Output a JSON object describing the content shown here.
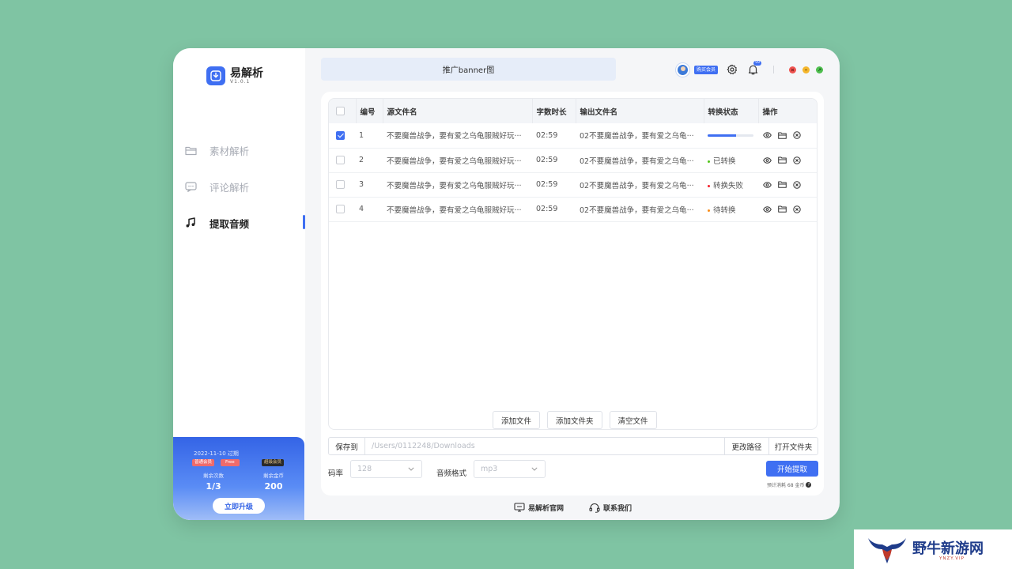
{
  "app": {
    "name": "易解析",
    "version": "V1.0.1"
  },
  "sidebar": {
    "items": [
      {
        "label": "素材解析",
        "icon": "folder-icon",
        "active": false
      },
      {
        "label": "评论解析",
        "icon": "comment-icon",
        "active": false
      },
      {
        "label": "提取音频",
        "icon": "music-note-icon",
        "active": true
      }
    ]
  },
  "member": {
    "expire": "2022-11-10 过期",
    "badge_normal": "普通会员",
    "badge_free": "Free",
    "badge_super": "超级会员",
    "remaining_times_label": "剩余次数",
    "remaining_times": "1/3",
    "remaining_coins_label": "剩余金币",
    "remaining_coins": "200",
    "upgrade_label": "立即升级"
  },
  "header": {
    "banner": "推广banner图",
    "buy_member": "购买会员",
    "bell_count": "99"
  },
  "table": {
    "columns": [
      "编号",
      "源文件名",
      "字数时长",
      "输出文件名",
      "转换状态",
      "操作"
    ],
    "rows": [
      {
        "id": "1",
        "source": "不要魔兽战争，要有爱之乌龟服贼好玩···",
        "duration": "02:59",
        "output": "02不要魔兽战争，要有爱之乌龟···",
        "status": "",
        "status_type": "progress",
        "progress": 0.62,
        "checked": true
      },
      {
        "id": "2",
        "source": "不要魔兽战争，要有爱之乌龟服贼好玩···",
        "duration": "02:59",
        "output": "02不要魔兽战争，要有爱之乌龟···",
        "status": "已转换",
        "status_type": "done",
        "status_color": "#52c41a",
        "checked": false
      },
      {
        "id": "3",
        "source": "不要魔兽战争，要有爱之乌龟服贼好玩···",
        "duration": "02:59",
        "output": "02不要魔兽战争，要有爱之乌龟···",
        "status": "转换失败",
        "status_type": "failed",
        "status_color": "#f5222d",
        "checked": false
      },
      {
        "id": "4",
        "source": "不要魔兽战争，要有爱之乌龟服贼好玩···",
        "duration": "02:59",
        "output": "02不要魔兽战争，要有爱之乌龟···",
        "status": "待转换",
        "status_type": "pending",
        "status_color": "#fa8c16",
        "checked": false
      }
    ]
  },
  "actions": {
    "add_file": "添加文件",
    "add_folder": "添加文件夹",
    "clear_files": "清空文件"
  },
  "save": {
    "label": "保存到",
    "path_placeholder": "/Users/0112248/Downloads",
    "change_path": "更改路径",
    "open_folder": "打开文件夹"
  },
  "options": {
    "bitrate_label": "码率",
    "bitrate_value": "128",
    "format_label": "音频格式",
    "format_value": "mp3"
  },
  "start": {
    "label": "开始提取",
    "cost": "预计消耗 68 金币"
  },
  "footer": {
    "website": "易解析官网",
    "contact": "联系我们"
  },
  "watermark": {
    "text": "野牛新游网",
    "sub": "YNZY.VIP"
  },
  "colors": {
    "accent": "#3f6ff2",
    "background": "#7fc4a3"
  }
}
